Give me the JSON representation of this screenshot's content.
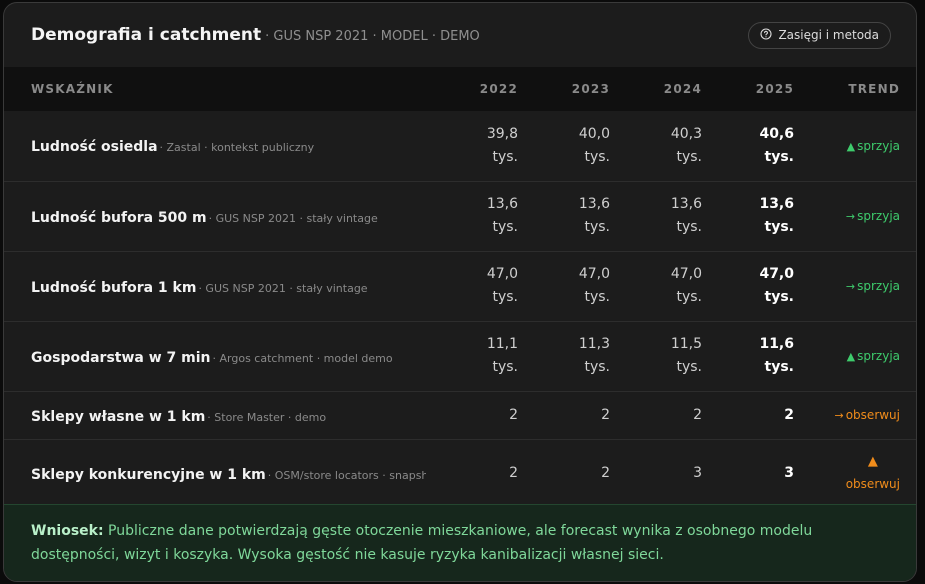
{
  "header": {
    "title": "Demografia i catchment",
    "subtitle": "· GUS NSP 2021 · MODEL · DEMO",
    "help_label": "Zasięgi i metoda",
    "help_icon": "question-circle-icon"
  },
  "table": {
    "columns": [
      "WSKAŹNIK",
      "2022",
      "2023",
      "2024",
      "2025",
      "TREND"
    ],
    "rows": [
      {
        "name": "Ludność osiedla",
        "source": "· Zastal · kontekst publiczny",
        "values": [
          "39,8",
          "40,0",
          "40,3",
          "40,6"
        ],
        "unit": "tys.",
        "trend": "sprzyja",
        "trend_icon": "▲",
        "trend_icon_name": "triangle-up-icon",
        "trend_color": "#3ecb6c"
      },
      {
        "name": "Ludność bufora 500 m",
        "source": "· GUS NSP 2021 · stały vintage",
        "values": [
          "13,6",
          "13,6",
          "13,6",
          "13,6"
        ],
        "unit": "tys.",
        "trend": "sprzyja",
        "trend_icon": "→",
        "trend_icon_name": "arrow-right-icon",
        "trend_color": "#3ecb6c"
      },
      {
        "name": "Ludność bufora 1 km",
        "source": "· GUS NSP 2021 · stały vintage",
        "values": [
          "47,0",
          "47,0",
          "47,0",
          "47,0"
        ],
        "unit": "tys.",
        "trend": "sprzyja",
        "trend_icon": "→",
        "trend_icon_name": "arrow-right-icon",
        "trend_color": "#3ecb6c"
      },
      {
        "name": "Gospodarstwa w 7 min",
        "source": "· Argos catchment · model demo",
        "values": [
          "11,1",
          "11,3",
          "11,5",
          "11,6"
        ],
        "unit": "tys.",
        "trend": "sprzyja",
        "trend_icon": "▲",
        "trend_icon_name": "triangle-up-icon",
        "trend_color": "#3ecb6c"
      },
      {
        "name": "Sklepy własne w 1 km",
        "source": "· Store Master · demo",
        "values": [
          "2",
          "2",
          "2",
          "2"
        ],
        "unit": "",
        "trend": "obserwuj",
        "trend_icon": "→",
        "trend_icon_name": "arrow-right-icon",
        "trend_color": "#f08c1b"
      },
      {
        "name": "Sklepy konkurencyjne w 1 km",
        "source": "· OSM/store locators · snapshoty",
        "values": [
          "2",
          "2",
          "3",
          "3"
        ],
        "unit": "",
        "trend": "obserwuj",
        "trend_icon": "▲",
        "trend_icon_name": "triangle-up-icon",
        "trend_color": "#f08c1b"
      }
    ]
  },
  "conclusion": {
    "label": "Wniosek:",
    "text": "Publiczne dane potwierdzają gęste otoczenie mieszkaniowe, ale forecast wynika z osobnego modelu dostępności, wizyt i koszyka. Wysoka gęstość nie kasuje ryzyka kanibalizacji własnej sieci."
  }
}
